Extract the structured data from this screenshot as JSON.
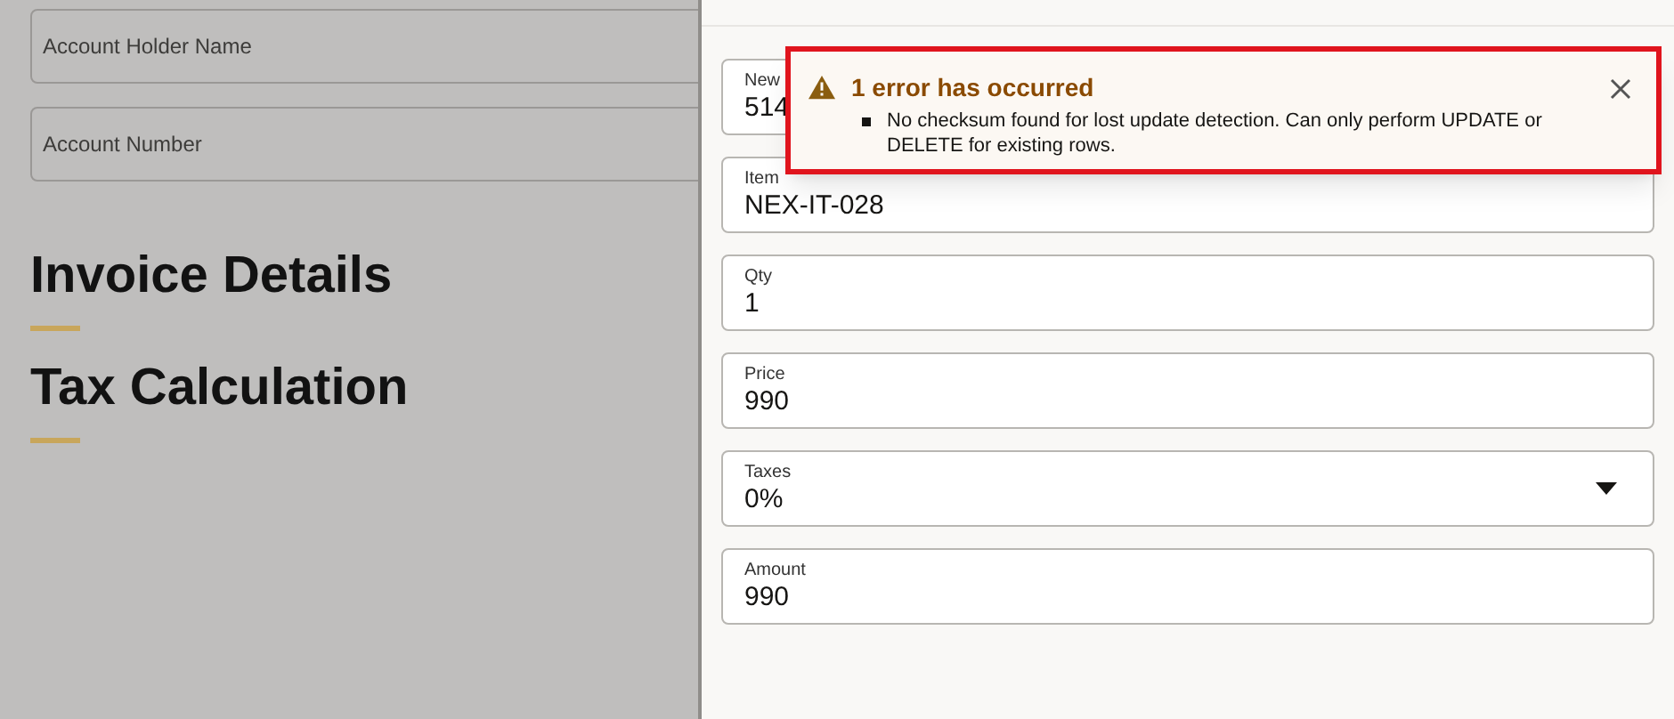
{
  "background": {
    "fields": [
      {
        "label": "Account Holder Name"
      },
      {
        "label": "Account Number"
      }
    ],
    "sections": [
      {
        "title": "Invoice Details"
      },
      {
        "title": "Tax Calculation"
      }
    ]
  },
  "drawer": {
    "fields": [
      {
        "kind": "text",
        "label": "New",
        "value": "514"
      },
      {
        "kind": "text",
        "label": "Item",
        "value": "NEX-IT-028"
      },
      {
        "kind": "text",
        "label": "Qty",
        "value": "1"
      },
      {
        "kind": "text",
        "label": "Price",
        "value": "990"
      },
      {
        "kind": "select",
        "label": "Taxes",
        "value": "0%"
      },
      {
        "kind": "text",
        "label": "Amount",
        "value": "990"
      }
    ]
  },
  "error": {
    "title": "1 error has occurred",
    "messages": [
      "No checksum found for lost update detection. Can only perform UPDATE or DELETE for existing rows."
    ]
  }
}
